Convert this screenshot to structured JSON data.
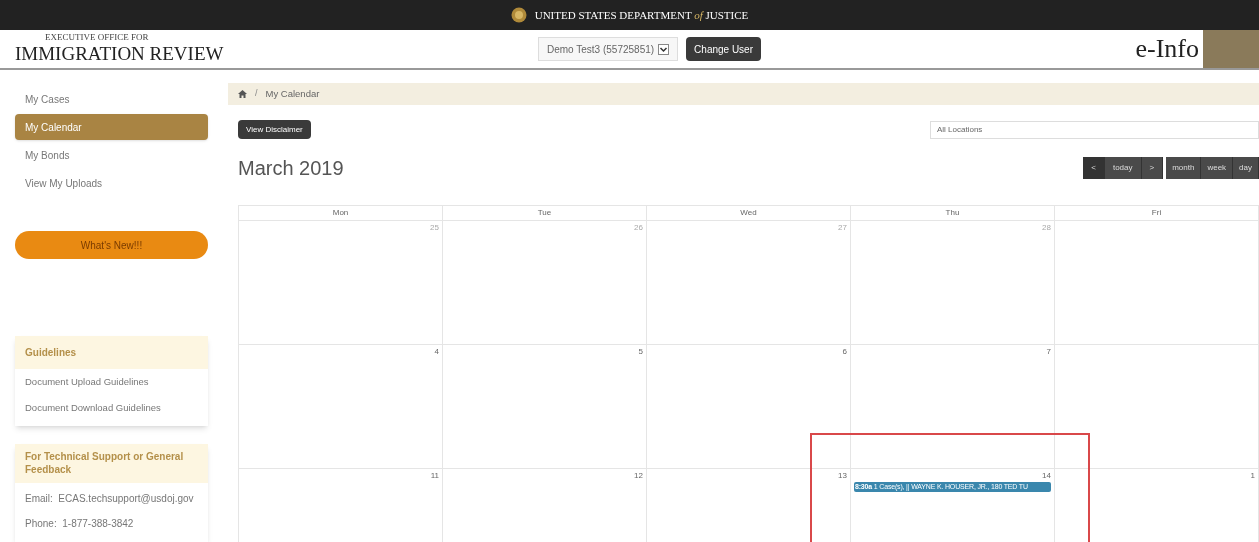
{
  "top_bar": {
    "title_left": "UNITED STATES DEPARTMENT",
    "title_connector": "of",
    "title_right": "JUSTICE"
  },
  "header": {
    "agency_line1": "EXECUTIVE OFFICE FOR",
    "agency_line2": "IMMIGRATION REVIEW",
    "user_select": "Demo Test3 (55725851)",
    "change_user_button": "Change User",
    "brand": "e-Info"
  },
  "sidebar": {
    "nav": [
      {
        "label": "My Cases",
        "selected": false
      },
      {
        "label": "My Calendar",
        "selected": true
      },
      {
        "label": "My Bonds",
        "selected": false
      },
      {
        "label": "View My Uploads",
        "selected": false
      }
    ],
    "whats_new_button": "What's New!!!",
    "guidelines": {
      "title": "Guidelines",
      "links": [
        "Document Upload Guidelines",
        "Document Download Guidelines"
      ]
    },
    "support": {
      "title": "For Technical Support or General Feedback",
      "lines": [
        "Email:  ECAS.techsupport@usdoj.gov",
        "Phone:  1-877-388-3842"
      ]
    }
  },
  "breadcrumb": {
    "separator": "/",
    "current": "My Calendar"
  },
  "toolbar": {
    "disclaimer_button": "View Disclaimer",
    "location_select": "All Locations"
  },
  "month_title": "March 2019",
  "nav_buttons": [
    "<",
    "today",
    ">"
  ],
  "view_buttons": [
    "month",
    "week",
    "day"
  ],
  "calendar": {
    "days": [
      "Mon",
      "Tue",
      "Wed",
      "Thu",
      "Fri"
    ],
    "weeks": [
      [
        {
          "day": "25",
          "other_month": true
        },
        {
          "day": "26",
          "other_month": true
        },
        {
          "day": "27",
          "other_month": true
        },
        {
          "day": "28",
          "other_month": true
        }
      ],
      [
        {
          "day": "4",
          "other_month": false
        },
        {
          "day": "5",
          "other_month": false
        },
        {
          "day": "6",
          "other_month": false
        },
        {
          "day": "7",
          "other_month": false
        }
      ],
      [
        {
          "day": "11",
          "other_month": false
        },
        {
          "day": "12",
          "other_month": false
        },
        {
          "day": "13",
          "other_month": false
        },
        {
          "day": "14",
          "other_month": false,
          "events": [
            {
              "time": "8:30a",
              "title": "1 Case(s), || WAYNE K. HOUSER, JR., 180 TED TU"
            }
          ]
        },
        {
          "day": "1",
          "other_month": false
        }
      ]
    ]
  }
}
